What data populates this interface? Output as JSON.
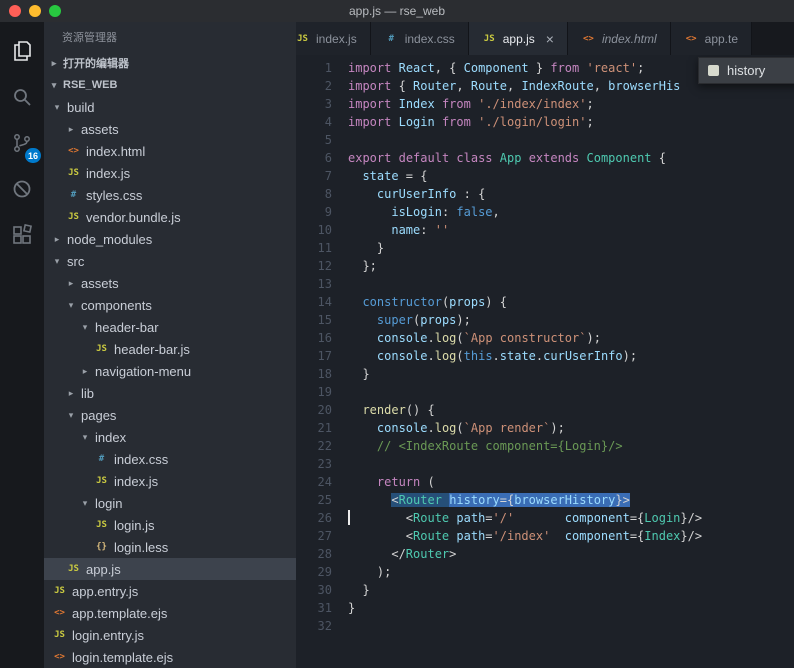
{
  "titlebar": {
    "title": "app.js — rse_web"
  },
  "colors": {
    "accent": "#007acc",
    "selection": "#264f78",
    "selection_strong": "#3a6db5"
  },
  "activity_bar": {
    "items": [
      {
        "name": "explorer",
        "active": true
      },
      {
        "name": "search"
      },
      {
        "name": "source-control",
        "badge": "16"
      },
      {
        "name": "debug"
      },
      {
        "name": "extensions"
      }
    ]
  },
  "file_icons": {
    "js": "JS",
    "css": "#",
    "html": "<>",
    "less": "{}"
  },
  "sidebar": {
    "title": "资源管理器",
    "glyphs": {
      "expanded": "▾",
      "collapsed": "▸"
    },
    "sections": {
      "open_editors": "打开的编辑器",
      "root": "RSE_WEB"
    },
    "tree": [
      {
        "label": "build",
        "kind": "folder",
        "expanded": true,
        "indent": 1
      },
      {
        "label": "assets",
        "kind": "folder",
        "expanded": false,
        "indent": 2
      },
      {
        "label": "index.html",
        "kind": "file",
        "type": "html",
        "indent": 2
      },
      {
        "label": "index.js",
        "kind": "file",
        "type": "js",
        "indent": 2
      },
      {
        "label": "styles.css",
        "kind": "file",
        "type": "css",
        "indent": 2
      },
      {
        "label": "vendor.bundle.js",
        "kind": "file",
        "type": "js",
        "indent": 2
      },
      {
        "label": "node_modules",
        "kind": "folder",
        "expanded": false,
        "indent": 1
      },
      {
        "label": "src",
        "kind": "folder",
        "expanded": true,
        "indent": 1
      },
      {
        "label": "assets",
        "kind": "folder",
        "expanded": false,
        "indent": 2
      },
      {
        "label": "components",
        "kind": "folder",
        "expanded": true,
        "indent": 2
      },
      {
        "label": "header-bar",
        "kind": "folder",
        "expanded": true,
        "indent": 3
      },
      {
        "label": "header-bar.js",
        "kind": "file",
        "type": "js",
        "indent": 4
      },
      {
        "label": "navigation-menu",
        "kind": "folder",
        "expanded": false,
        "indent": 3
      },
      {
        "label": "lib",
        "kind": "folder",
        "expanded": false,
        "indent": 2
      },
      {
        "label": "pages",
        "kind": "folder",
        "expanded": true,
        "indent": 2
      },
      {
        "label": "index",
        "kind": "folder",
        "expanded": true,
        "indent": 3
      },
      {
        "label": "index.css",
        "kind": "file",
        "type": "css",
        "indent": 4
      },
      {
        "label": "index.js",
        "kind": "file",
        "type": "js",
        "indent": 4
      },
      {
        "label": "login",
        "kind": "folder",
        "expanded": true,
        "indent": 3
      },
      {
        "label": "login.js",
        "kind": "file",
        "type": "js",
        "indent": 4
      },
      {
        "label": "login.less",
        "kind": "file",
        "type": "less",
        "indent": 4
      },
      {
        "label": "app.js",
        "kind": "file",
        "type": "js",
        "indent": 2,
        "selected": true
      },
      {
        "label": "app.entry.js",
        "kind": "file",
        "type": "js",
        "indent": 1
      },
      {
        "label": "app.template.ejs",
        "kind": "file",
        "type": "html",
        "indent": 1
      },
      {
        "label": "login.entry.js",
        "kind": "file",
        "type": "js",
        "indent": 1
      },
      {
        "label": "login.template.ejs",
        "kind": "file",
        "type": "html",
        "indent": 1
      }
    ]
  },
  "tabs": [
    {
      "label": "index.js",
      "type": "js",
      "clipped_left": true
    },
    {
      "label": "index.css",
      "type": "css"
    },
    {
      "label": "app.js",
      "type": "js",
      "active": true,
      "close": true
    },
    {
      "label": "index.html",
      "type": "html",
      "preview": true
    },
    {
      "label": "app.te",
      "type": "html"
    }
  ],
  "suggest": {
    "label": "history"
  },
  "editor": {
    "line_count": 32,
    "lines": [
      {
        "s": [
          [
            "kw",
            "import"
          ],
          [
            "d",
            " "
          ],
          [
            "var",
            "React"
          ],
          [
            "d",
            ", { "
          ],
          [
            "var",
            "Component"
          ],
          [
            "d",
            " } "
          ],
          [
            "kw",
            "from"
          ],
          [
            "d",
            " "
          ],
          [
            "str",
            "'react'"
          ],
          [
            "d",
            ";"
          ]
        ]
      },
      {
        "s": [
          [
            "kw",
            "import"
          ],
          [
            "d",
            " { "
          ],
          [
            "var",
            "Router"
          ],
          [
            "d",
            ", "
          ],
          [
            "var",
            "Route"
          ],
          [
            "d",
            ", "
          ],
          [
            "var",
            "IndexRoute"
          ],
          [
            "d",
            ", "
          ],
          [
            "var",
            "browserHis"
          ]
        ]
      },
      {
        "s": [
          [
            "kw",
            "import"
          ],
          [
            "d",
            " "
          ],
          [
            "var",
            "Index"
          ],
          [
            "d",
            " "
          ],
          [
            "kw",
            "from"
          ],
          [
            "d",
            " "
          ],
          [
            "str",
            "'./index/index'"
          ],
          [
            "d",
            ";"
          ]
        ]
      },
      {
        "s": [
          [
            "kw",
            "import"
          ],
          [
            "d",
            " "
          ],
          [
            "var",
            "Login"
          ],
          [
            "d",
            " "
          ],
          [
            "kw",
            "from"
          ],
          [
            "d",
            " "
          ],
          [
            "str",
            "'./login/login'"
          ],
          [
            "d",
            ";"
          ]
        ]
      },
      {
        "s": []
      },
      {
        "s": [
          [
            "kw",
            "export"
          ],
          [
            "d",
            " "
          ],
          [
            "kw",
            "default"
          ],
          [
            "d",
            " "
          ],
          [
            "kw",
            "class"
          ],
          [
            "d",
            " "
          ],
          [
            "type",
            "App"
          ],
          [
            "d",
            " "
          ],
          [
            "kw",
            "extends"
          ],
          [
            "d",
            " "
          ],
          [
            "type",
            "Component"
          ],
          [
            "d",
            " {"
          ]
        ]
      },
      {
        "s": [
          [
            "d",
            "  "
          ],
          [
            "var",
            "state"
          ],
          [
            "d",
            " = {"
          ]
        ]
      },
      {
        "s": [
          [
            "d",
            "    "
          ],
          [
            "var",
            "curUserInfo"
          ],
          [
            "d",
            " : {"
          ]
        ]
      },
      {
        "s": [
          [
            "d",
            "      "
          ],
          [
            "var",
            "isLogin"
          ],
          [
            "d",
            ": "
          ],
          [
            "b",
            "false"
          ],
          [
            "d",
            ","
          ]
        ]
      },
      {
        "s": [
          [
            "d",
            "      "
          ],
          [
            "var",
            "name"
          ],
          [
            "d",
            ": "
          ],
          [
            "str",
            "''"
          ]
        ]
      },
      {
        "s": [
          [
            "d",
            "    }"
          ]
        ]
      },
      {
        "s": [
          [
            "d",
            "  };"
          ]
        ]
      },
      {
        "s": []
      },
      {
        "s": [
          [
            "d",
            "  "
          ],
          [
            "b",
            "constructor"
          ],
          [
            "d",
            "("
          ],
          [
            "var",
            "props"
          ],
          [
            "d",
            ") {"
          ]
        ]
      },
      {
        "s": [
          [
            "d",
            "    "
          ],
          [
            "b",
            "super"
          ],
          [
            "d",
            "("
          ],
          [
            "var",
            "props"
          ],
          [
            "d",
            ");"
          ]
        ]
      },
      {
        "s": [
          [
            "d",
            "    "
          ],
          [
            "var",
            "console"
          ],
          [
            "d",
            "."
          ],
          [
            "fn",
            "log"
          ],
          [
            "d",
            "("
          ],
          [
            "str",
            "`App constructor`"
          ],
          [
            "d",
            ");"
          ]
        ]
      },
      {
        "s": [
          [
            "d",
            "    "
          ],
          [
            "var",
            "console"
          ],
          [
            "d",
            "."
          ],
          [
            "fn",
            "log"
          ],
          [
            "d",
            "("
          ],
          [
            "b",
            "this"
          ],
          [
            "d",
            "."
          ],
          [
            "var",
            "state"
          ],
          [
            "d",
            "."
          ],
          [
            "var",
            "curUserInfo"
          ],
          [
            "d",
            ");"
          ]
        ]
      },
      {
        "s": [
          [
            "d",
            "  }"
          ]
        ]
      },
      {
        "s": []
      },
      {
        "s": [
          [
            "d",
            "  "
          ],
          [
            "fn",
            "render"
          ],
          [
            "d",
            "() {"
          ]
        ]
      },
      {
        "s": [
          [
            "d",
            "    "
          ],
          [
            "var",
            "console"
          ],
          [
            "d",
            "."
          ],
          [
            "fn",
            "log"
          ],
          [
            "d",
            "("
          ],
          [
            "str",
            "`App render`"
          ],
          [
            "d",
            ");"
          ]
        ]
      },
      {
        "s": [
          [
            "d",
            "    "
          ],
          [
            "cm",
            "// <IndexRoute component={Login}/>"
          ]
        ]
      },
      {
        "s": []
      },
      {
        "s": [
          [
            "d",
            "    "
          ],
          [
            "kw",
            "return"
          ],
          [
            "d",
            " ("
          ]
        ]
      },
      {
        "s": [
          [
            "d",
            "      "
          ],
          [
            "d",
            "<",
            "sel"
          ],
          [
            "type",
            "Router",
            "sel"
          ],
          [
            "d",
            " ",
            "sel"
          ],
          [
            "var",
            "history",
            "sel2"
          ],
          [
            "d",
            "={",
            "sel2"
          ],
          [
            "var",
            "browserHistory",
            "sel2"
          ],
          [
            "d",
            "}",
            "sel2"
          ],
          [
            "d",
            ">",
            "sel2"
          ]
        ]
      },
      {
        "cur": true,
        "s": [
          [
            "d",
            "        <"
          ],
          [
            "type",
            "Route"
          ],
          [
            "d",
            " "
          ],
          [
            "var",
            "path"
          ],
          [
            "d",
            "="
          ],
          [
            "str",
            "'/'"
          ],
          [
            "d",
            "       "
          ],
          [
            "var",
            "component"
          ],
          [
            "d",
            "={"
          ],
          [
            "type",
            "Login"
          ],
          [
            "d",
            "}/>"
          ]
        ]
      },
      {
        "s": [
          [
            "d",
            "        <"
          ],
          [
            "type",
            "Route"
          ],
          [
            "d",
            " "
          ],
          [
            "var",
            "path"
          ],
          [
            "d",
            "="
          ],
          [
            "str",
            "'/index'"
          ],
          [
            "d",
            "  "
          ],
          [
            "var",
            "component"
          ],
          [
            "d",
            "={"
          ],
          [
            "type",
            "Index"
          ],
          [
            "d",
            "}/>"
          ]
        ]
      },
      {
        "s": [
          [
            "d",
            "      </"
          ],
          [
            "type",
            "Router"
          ],
          [
            "d",
            ">"
          ]
        ]
      },
      {
        "s": [
          [
            "d",
            "    );"
          ]
        ]
      },
      {
        "s": [
          [
            "d",
            "  }"
          ]
        ]
      },
      {
        "s": [
          [
            "d",
            "}"
          ]
        ]
      },
      {
        "s": []
      }
    ]
  }
}
